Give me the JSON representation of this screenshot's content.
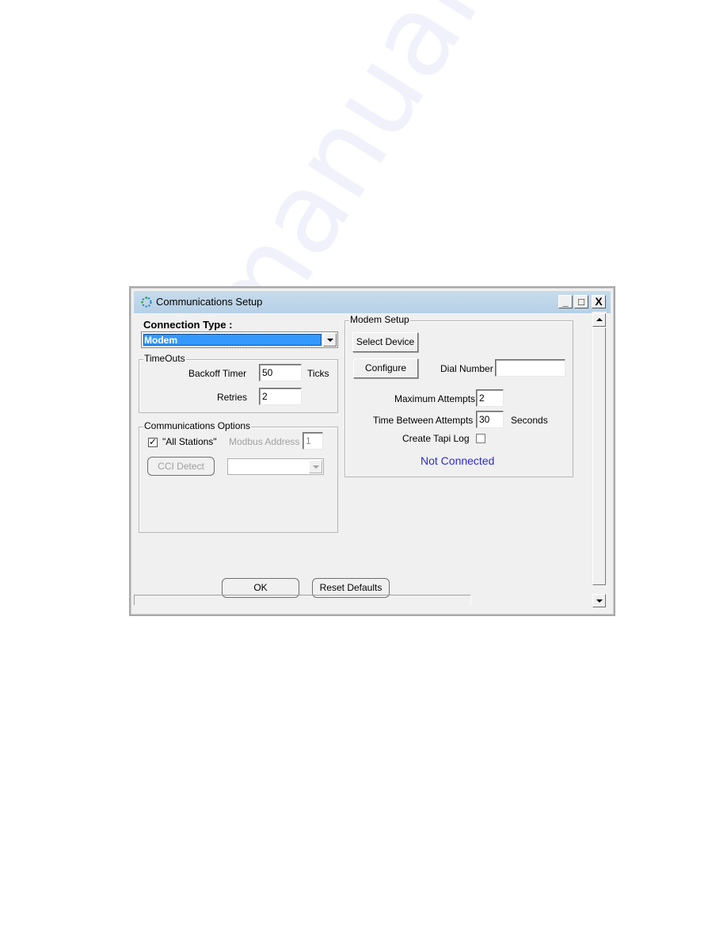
{
  "window": {
    "title": "Communications Setup",
    "icon": "connection-icon",
    "controls": {
      "minimize": "_",
      "maximize": "□",
      "close": "X"
    }
  },
  "connection": {
    "label": "Connection Type :",
    "selected": "Modem",
    "highlight_color": "#3399ff"
  },
  "timeouts": {
    "legend": "TimeOuts",
    "backoff_label": "Backoff Timer",
    "backoff_value": "50",
    "backoff_unit": "Ticks",
    "retries_label": "Retries",
    "retries_value": "2"
  },
  "comm_options": {
    "legend": "Communications Options",
    "all_stations_label": "\"All Stations\"",
    "all_stations_checked": true,
    "modbus_label": "Modbus Address",
    "modbus_value": "1",
    "cci_detect_label": "CCI Detect",
    "cci_combo_value": ""
  },
  "modem": {
    "legend": "Modem Setup",
    "select_device_label": "Select Device",
    "configure_label": "Configure",
    "dial_number_label": "Dial Number",
    "dial_number_value": "",
    "max_attempts_label": "Maximum Attempts",
    "max_attempts_value": "2",
    "time_between_label": "Time Between Attempts",
    "time_between_value": "30",
    "time_between_unit": "Seconds",
    "tapi_log_label": "Create Tapi Log",
    "tapi_log_checked": false,
    "status_text": "Not Connected",
    "status_color": "#2b2bd8"
  },
  "footer": {
    "ok_label": "OK",
    "reset_label": "Reset Defaults"
  },
  "watermark": "manualsarchive.com"
}
